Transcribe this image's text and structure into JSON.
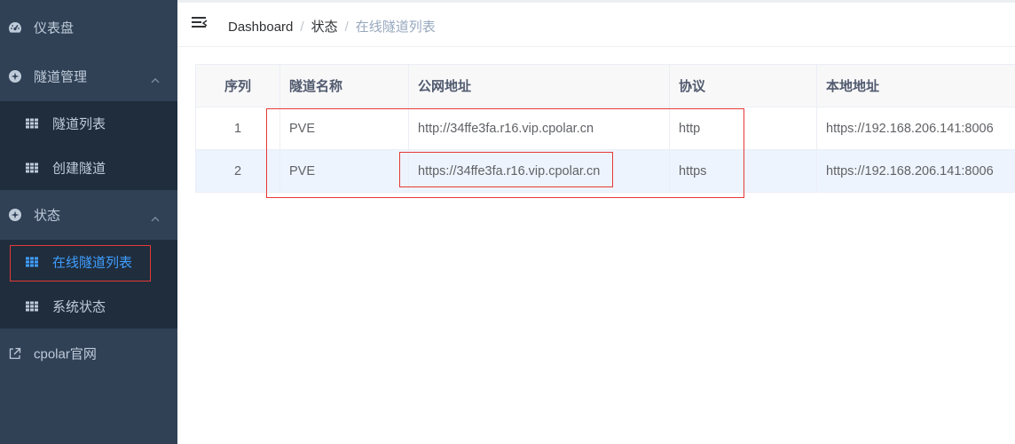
{
  "sidebar": {
    "dashboard": "仪表盘",
    "tunnel_mgmt": "隧道管理",
    "tunnel_list": "隧道列表",
    "create_tunnel": "创建隧道",
    "status": "状态",
    "online_tunnels": "在线隧道列表",
    "system_status": "系统状态",
    "cpolar_site": "cpolar官网"
  },
  "breadcrumb": {
    "home": "Dashboard",
    "sep": "/",
    "parent": "状态",
    "current": "在线隧道列表"
  },
  "table": {
    "headers": [
      "序列",
      "隧道名称",
      "公网地址",
      "协议",
      "本地地址"
    ],
    "rows": [
      [
        "1",
        "PVE",
        "http://34ffe3fa.r16.vip.cpolar.cn",
        "http",
        "https://192.168.206.141:8006"
      ],
      [
        "2",
        "PVE",
        "https://34ffe3fa.r16.vip.cpolar.cn",
        "https",
        "https://192.168.206.141:8006"
      ]
    ]
  },
  "colors": {
    "sidebar_bg": "#304156",
    "submenu_bg": "#1f2d3d",
    "active": "#409eff",
    "highlight_box": "#e53935"
  }
}
